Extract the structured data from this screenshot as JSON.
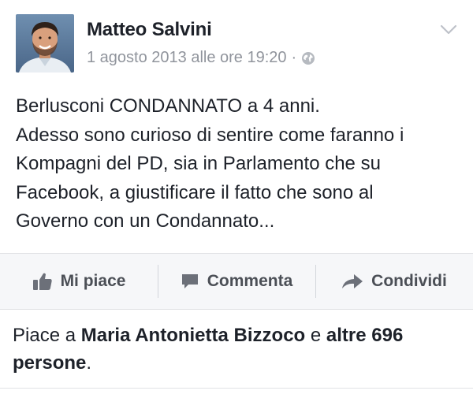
{
  "post": {
    "author": "Matteo Salvini",
    "timestamp": "1 agosto 2013 alle ore 19:20",
    "separator": "·",
    "audience_icon": "globe-icon",
    "menu_icon": "chevron-down-icon",
    "body_lines": [
      "Berlusconi CONDANNATO a 4 anni.",
      "Adesso sono curioso di sentire come faranno i",
      "Kompagni del PD, sia in Parlamento che su",
      "Facebook, a giustificare il fatto che sono al",
      "Governo con un Condannato..."
    ]
  },
  "actions": {
    "like": {
      "label": "Mi piace",
      "icon": "thumbs-up-icon"
    },
    "comment": {
      "label": "Commenta",
      "icon": "speech-bubble-icon"
    },
    "share": {
      "label": "Condividi",
      "icon": "share-arrow-icon"
    }
  },
  "likes": {
    "prefix": "Piace a",
    "name": "Maria Antonietta Bizzoco",
    "conjunction": "e",
    "others": "altre 696 persone",
    "suffix": "."
  },
  "colors": {
    "text": "#1d2129",
    "meta": "#90949c",
    "action_text": "#4b4f56",
    "action_bar_bg": "#f6f7f9",
    "divider": "#e1e2e5"
  }
}
